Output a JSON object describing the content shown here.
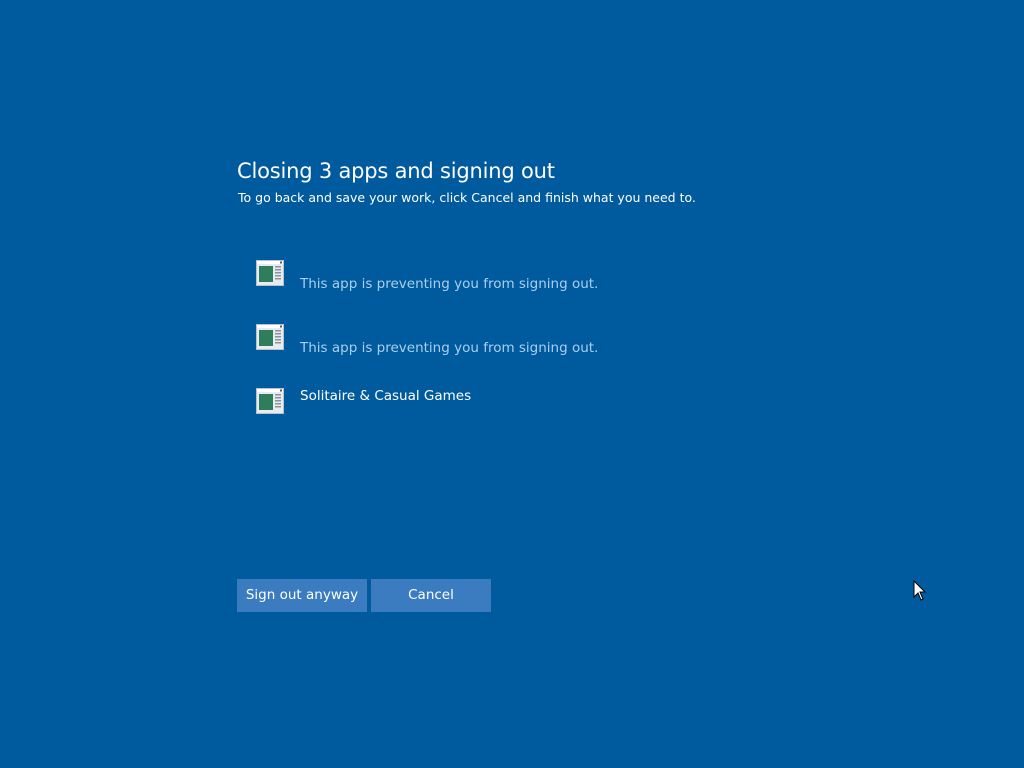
{
  "dialog": {
    "title": "Closing 3 apps and signing out",
    "subtitle": "To go back and save your work, click Cancel and finish what you need to."
  },
  "apps": [
    {
      "name": "",
      "status": "This app is preventing you from signing out.",
      "icon": "app-window-icon"
    },
    {
      "name": "",
      "status": "This app is preventing you from signing out.",
      "icon": "app-window-icon"
    },
    {
      "name": "Solitaire & Casual Games",
      "status": "",
      "icon": "app-window-icon"
    }
  ],
  "buttons": {
    "sign_out_label": "Sign out anyway",
    "cancel_label": "Cancel"
  },
  "colors": {
    "background": "#005a9e",
    "button": "#3a7cbf",
    "status_text": "#a9cff0"
  }
}
